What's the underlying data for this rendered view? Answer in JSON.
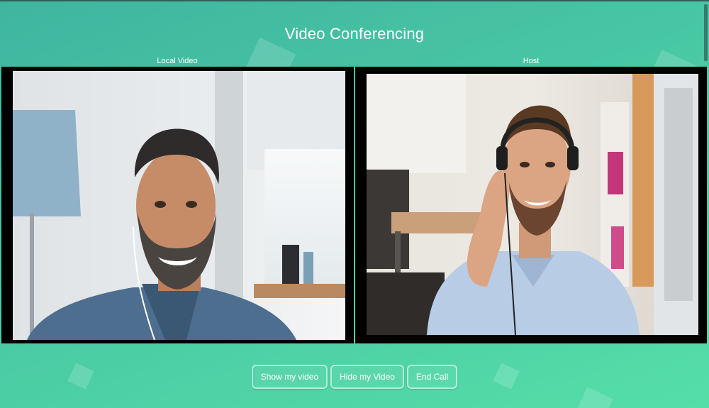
{
  "app": {
    "title": "Video Conferencing"
  },
  "videos": {
    "local": {
      "label": "Local Video",
      "image": "smiling bearded man with earphones"
    },
    "host": {
      "label": "Host",
      "image": "smiling man wearing headphones in office"
    }
  },
  "controls": {
    "show_video_label": "Show my video",
    "hide_video_label": "Hide my Video",
    "end_call_label": "End Call"
  },
  "colors": {
    "background_start": "#3fb5a0",
    "background_end": "#55dea8",
    "frame": "#000000",
    "text": "#ffffff"
  }
}
